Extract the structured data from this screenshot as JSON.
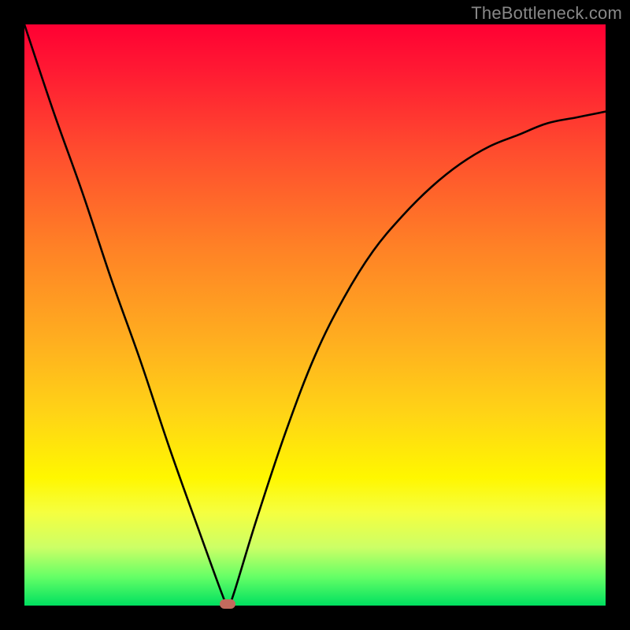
{
  "watermark": "TheBottleneck.com",
  "chart_data": {
    "type": "line",
    "title": "",
    "xlabel": "",
    "ylabel": "",
    "xlim": [
      0,
      100
    ],
    "ylim": [
      0,
      100
    ],
    "background_gradient": [
      "#ff0033",
      "#ffb01f",
      "#fff700",
      "#00e060"
    ],
    "legend": false,
    "grid": false,
    "series": [
      {
        "name": "curve",
        "x": [
          0,
          5,
          10,
          15,
          20,
          25,
          30,
          34,
          35,
          36,
          40,
          45,
          50,
          55,
          60,
          65,
          70,
          75,
          80,
          85,
          90,
          95,
          100
        ],
        "values": [
          100,
          85,
          71,
          56,
          42,
          27,
          13,
          2,
          0,
          2,
          15,
          30,
          43,
          53,
          61,
          67,
          72,
          76,
          79,
          81,
          83,
          84,
          85
        ]
      }
    ],
    "annotations": [
      {
        "name": "min-marker",
        "x": 35,
        "y": 0,
        "shape": "pill",
        "color": "#c36a5d"
      }
    ]
  }
}
